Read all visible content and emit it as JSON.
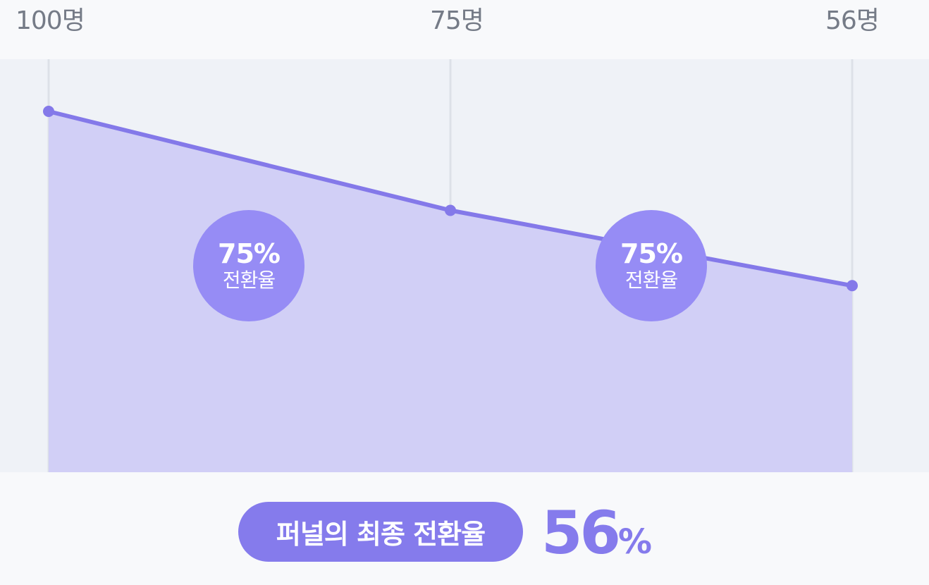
{
  "chart_data": {
    "type": "area",
    "categories": [
      "100명",
      "75명",
      "56명"
    ],
    "values": [
      100,
      75,
      56
    ],
    "ylim": [
      0,
      100
    ],
    "step_rates": [
      {
        "percent": "75%",
        "label": "전환율"
      },
      {
        "percent": "75%",
        "label": "전환율"
      }
    ],
    "line_color": "#8479e9",
    "fill_color": "#d1cff6",
    "grid_color": "#dde1e8"
  },
  "summary": {
    "label": "퍼널의 최종 전환율",
    "value": "56",
    "unit": "%"
  }
}
